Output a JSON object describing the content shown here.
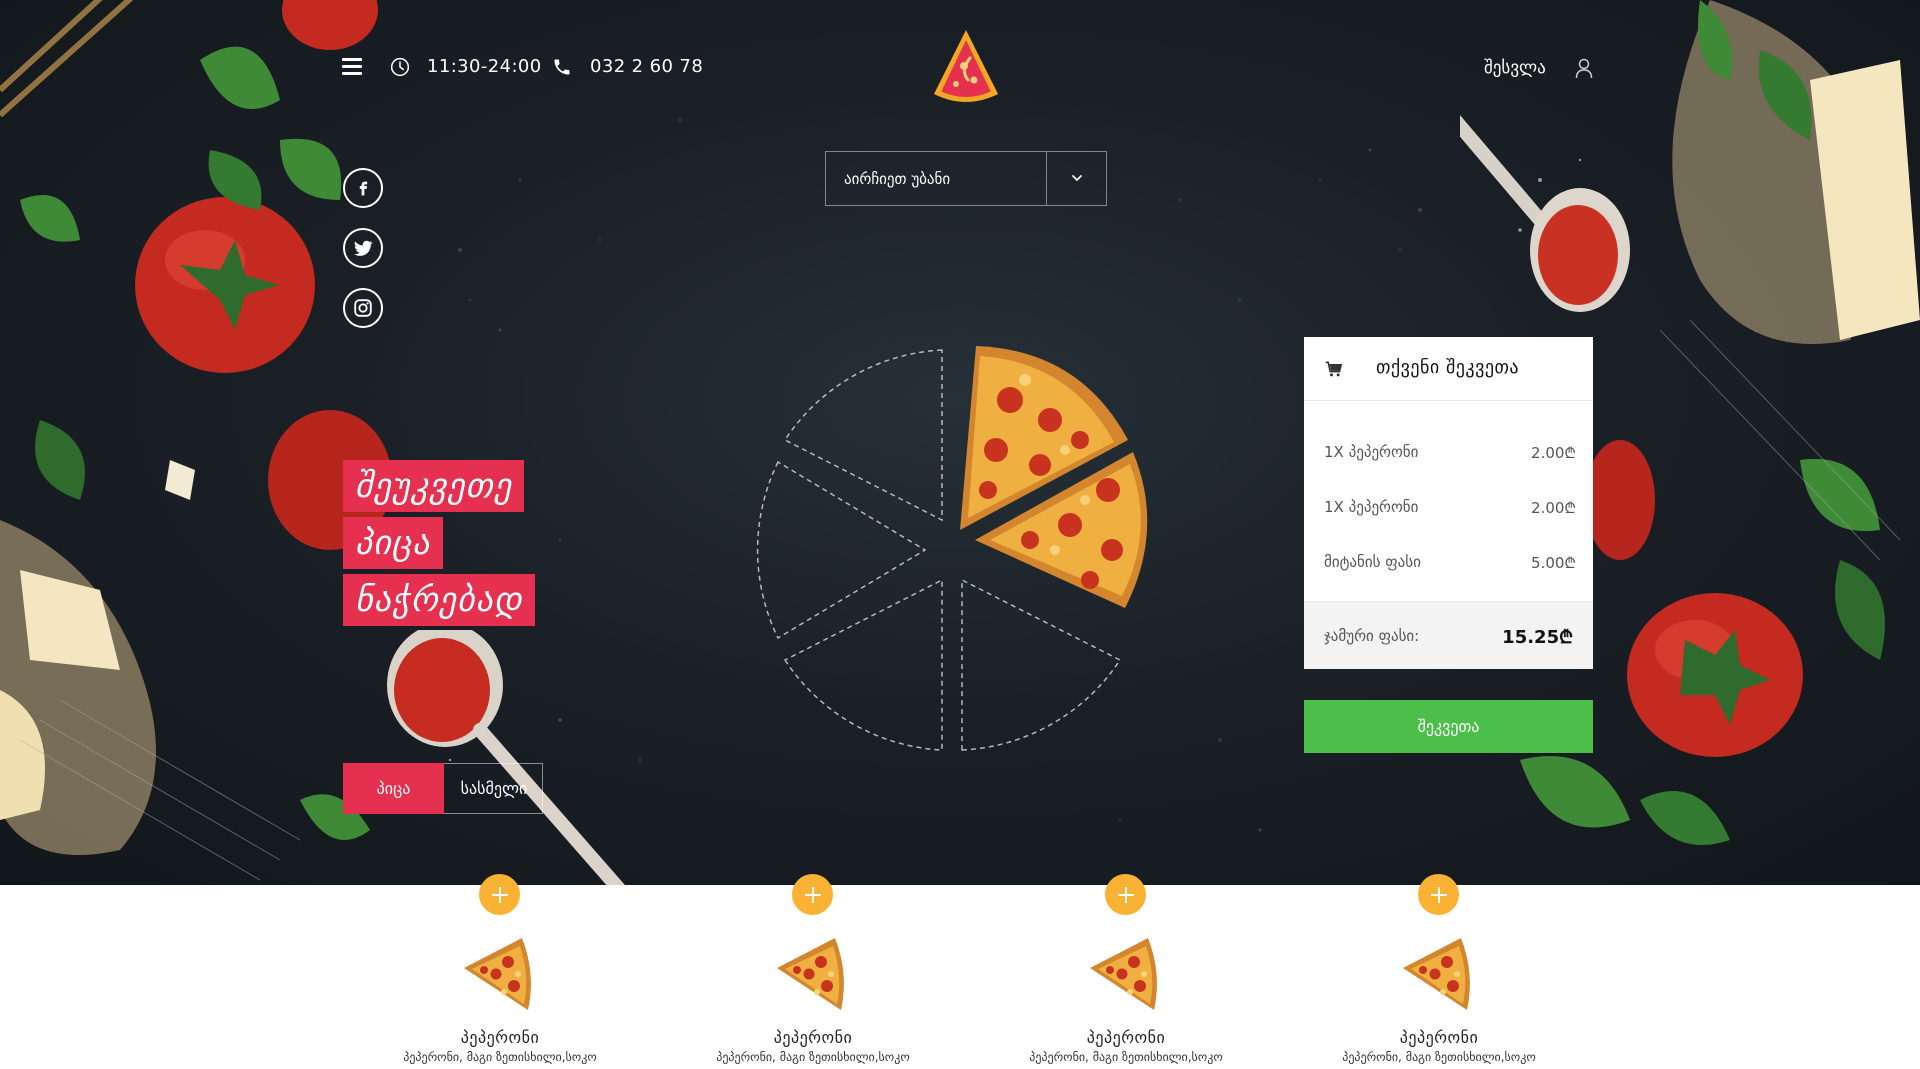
{
  "header": {
    "hours": "11:30-24:00",
    "phone": "032 2 60 78",
    "login_label": "შესვლა"
  },
  "branch_select": {
    "label": "აირჩიეთ უბანი"
  },
  "socials": [
    "facebook-icon",
    "twitter-icon",
    "instagram-icon"
  ],
  "headline": [
    "შეუკვეთე",
    "პიცა",
    "ნაჭრებად"
  ],
  "categories": {
    "active": "პიცა",
    "inactive": "სასმელი"
  },
  "cart": {
    "title": "თქვენი შეკვეთა",
    "items": [
      {
        "name": "1X პეპერონი",
        "price": "2.00₾"
      },
      {
        "name": "1X პეპერონი",
        "price": "2.00₾"
      },
      {
        "name": "მიტანის ფასი",
        "price": "5.00₾"
      }
    ],
    "total_label": "ჯამური ფასი:",
    "total_value": "15.25₾",
    "order_button": "შეკვეთა"
  },
  "products": [
    {
      "name": "პეპერონი",
      "desc": "პეპერონი, მაგი ზეთისხილი,სოკო"
    },
    {
      "name": "პეპერონი",
      "desc": "პეპერონი, მაგი ზეთისხილი,სოკო"
    },
    {
      "name": "პეპერონი",
      "desc": "პეპერონი, მაგი ზეთისხილი,სოკო"
    },
    {
      "name": "პეპერონი",
      "desc": "პეპერონი, მაგი ზეთისხილი,სოკო"
    }
  ],
  "colors": {
    "accent_red": "#e5304f",
    "order_green": "#4cbf4a",
    "add_orange": "#f9b233"
  }
}
